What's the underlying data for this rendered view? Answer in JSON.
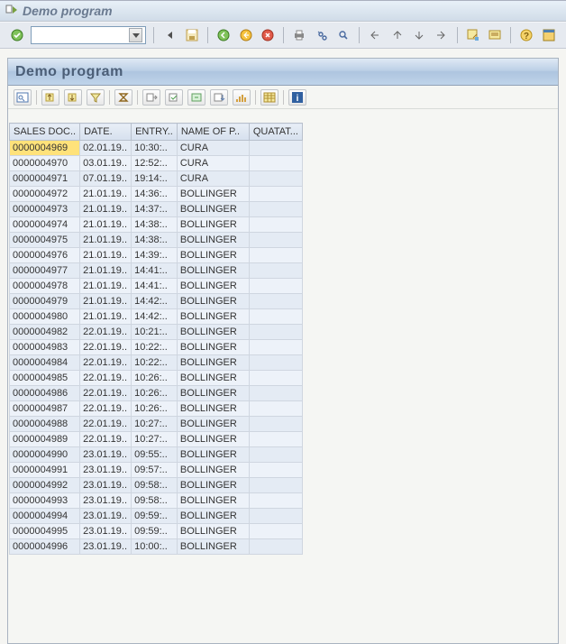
{
  "window": {
    "title": "Demo program"
  },
  "app": {
    "heading": "Demo program"
  },
  "grid": {
    "columns": {
      "salesdoc": "SALES DOC..",
      "date": "DATE.",
      "entry": "ENTRY..",
      "name": "NAME OF P..",
      "quatat": "QUATAT..."
    },
    "rows": [
      {
        "salesdoc": "0000004969",
        "date": "02.01.19..",
        "entry": "10:30:..",
        "name": "CURA",
        "quatat": ""
      },
      {
        "salesdoc": "0000004970",
        "date": "03.01.19..",
        "entry": "12:52:..",
        "name": "CURA",
        "quatat": ""
      },
      {
        "salesdoc": "0000004971",
        "date": "07.01.19..",
        "entry": "19:14:..",
        "name": "CURA",
        "quatat": ""
      },
      {
        "salesdoc": "0000004972",
        "date": "21.01.19..",
        "entry": "14:36:..",
        "name": "BOLLINGER",
        "quatat": ""
      },
      {
        "salesdoc": "0000004973",
        "date": "21.01.19..",
        "entry": "14:37:..",
        "name": "BOLLINGER",
        "quatat": ""
      },
      {
        "salesdoc": "0000004974",
        "date": "21.01.19..",
        "entry": "14:38:..",
        "name": "BOLLINGER",
        "quatat": ""
      },
      {
        "salesdoc": "0000004975",
        "date": "21.01.19..",
        "entry": "14:38:..",
        "name": "BOLLINGER",
        "quatat": ""
      },
      {
        "salesdoc": "0000004976",
        "date": "21.01.19..",
        "entry": "14:39:..",
        "name": "BOLLINGER",
        "quatat": ""
      },
      {
        "salesdoc": "0000004977",
        "date": "21.01.19..",
        "entry": "14:41:..",
        "name": "BOLLINGER",
        "quatat": ""
      },
      {
        "salesdoc": "0000004978",
        "date": "21.01.19..",
        "entry": "14:41:..",
        "name": "BOLLINGER",
        "quatat": ""
      },
      {
        "salesdoc": "0000004979",
        "date": "21.01.19..",
        "entry": "14:42:..",
        "name": "BOLLINGER",
        "quatat": ""
      },
      {
        "salesdoc": "0000004980",
        "date": "21.01.19..",
        "entry": "14:42:..",
        "name": "BOLLINGER",
        "quatat": ""
      },
      {
        "salesdoc": "0000004982",
        "date": "22.01.19..",
        "entry": "10:21:..",
        "name": "BOLLINGER",
        "quatat": ""
      },
      {
        "salesdoc": "0000004983",
        "date": "22.01.19..",
        "entry": "10:22:..",
        "name": "BOLLINGER",
        "quatat": ""
      },
      {
        "salesdoc": "0000004984",
        "date": "22.01.19..",
        "entry": "10:22:..",
        "name": "BOLLINGER",
        "quatat": ""
      },
      {
        "salesdoc": "0000004985",
        "date": "22.01.19..",
        "entry": "10:26:..",
        "name": "BOLLINGER",
        "quatat": ""
      },
      {
        "salesdoc": "0000004986",
        "date": "22.01.19..",
        "entry": "10:26:..",
        "name": "BOLLINGER",
        "quatat": ""
      },
      {
        "salesdoc": "0000004987",
        "date": "22.01.19..",
        "entry": "10:26:..",
        "name": "BOLLINGER",
        "quatat": ""
      },
      {
        "salesdoc": "0000004988",
        "date": "22.01.19..",
        "entry": "10:27:..",
        "name": "BOLLINGER",
        "quatat": ""
      },
      {
        "salesdoc": "0000004989",
        "date": "22.01.19..",
        "entry": "10:27:..",
        "name": "BOLLINGER",
        "quatat": ""
      },
      {
        "salesdoc": "0000004990",
        "date": "23.01.19..",
        "entry": "09:55:..",
        "name": "BOLLINGER",
        "quatat": ""
      },
      {
        "salesdoc": "0000004991",
        "date": "23.01.19..",
        "entry": "09:57:..",
        "name": "BOLLINGER",
        "quatat": ""
      },
      {
        "salesdoc": "0000004992",
        "date": "23.01.19..",
        "entry": "09:58:..",
        "name": "BOLLINGER",
        "quatat": ""
      },
      {
        "salesdoc": "0000004993",
        "date": "23.01.19..",
        "entry": "09:58:..",
        "name": "BOLLINGER",
        "quatat": ""
      },
      {
        "salesdoc": "0000004994",
        "date": "23.01.19..",
        "entry": "09:59:..",
        "name": "BOLLINGER",
        "quatat": ""
      },
      {
        "salesdoc": "0000004995",
        "date": "23.01.19..",
        "entry": "09:59:..",
        "name": "BOLLINGER",
        "quatat": ""
      },
      {
        "salesdoc": "0000004996",
        "date": "23.01.19..",
        "entry": "10:00:..",
        "name": "BOLLINGER",
        "quatat": ""
      }
    ]
  }
}
